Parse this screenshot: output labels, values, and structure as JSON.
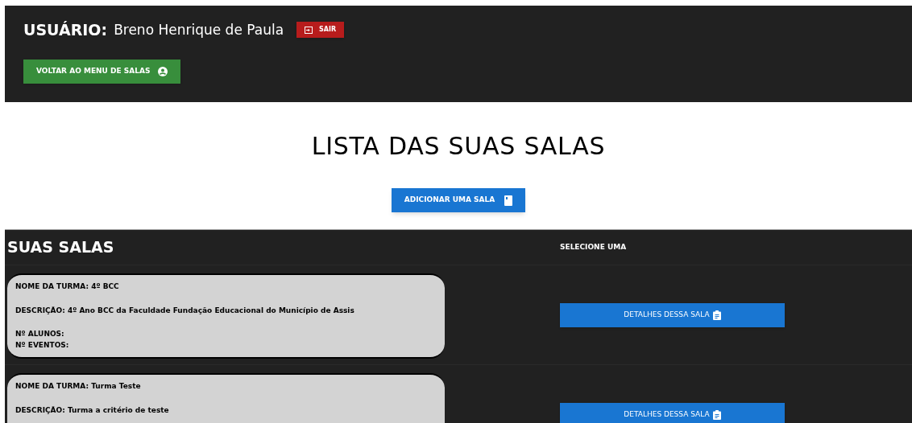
{
  "header": {
    "user_label": "USUÁRIO:",
    "user_name": "Breno Henrique de Paula",
    "logout_button": "SAIR",
    "back_button": "VOLTAR AO MENU DE SALAS"
  },
  "page_title": "LISTA DAS SUAS SALAS",
  "add_button": "ADICIONAR UMA SALA",
  "table": {
    "columns": [
      "SUAS SALAS",
      "SELECIONE UMA"
    ],
    "rows": [
      {
        "fields": [
          {
            "label": "NOME DA TURMA:",
            "value": "4º BCC"
          },
          {
            "label": "DESCRIÇÃO:",
            "value": "4º Ano BCC da Faculdade Fundação Educacional do Município de Assis"
          },
          {
            "label": "Nº ALUNOS:"
          },
          {
            "label": "Nº EVENTOS:"
          }
        ],
        "button": "DETALHES DESSA SALA"
      },
      {
        "fields": [
          {
            "label": "NOME DA TURMA:",
            "value": "Turma Teste"
          },
          {
            "label": "DESCRIÇÃO:",
            "value": "Turma a critério de teste"
          }
        ],
        "button": "DETALHES DESSA SALA"
      }
    ]
  }
}
